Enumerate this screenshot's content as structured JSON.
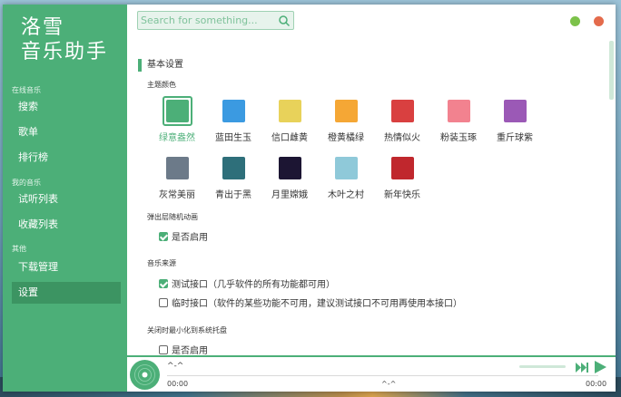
{
  "app": {
    "logo_line1": "洛雪",
    "logo_line2": "音乐助手"
  },
  "sidebar": {
    "sections": [
      {
        "title": "在线音乐",
        "items": [
          {
            "label": "搜索"
          },
          {
            "label": "歌单"
          },
          {
            "label": "排行榜"
          }
        ]
      },
      {
        "title": "我的音乐",
        "items": [
          {
            "label": "试听列表"
          },
          {
            "label": "收藏列表"
          }
        ]
      },
      {
        "title": "其他",
        "items": [
          {
            "label": "下载管理"
          },
          {
            "label": "设置",
            "active": true
          }
        ]
      }
    ]
  },
  "search": {
    "placeholder": "Search for something..."
  },
  "settings": {
    "section_title": "基本设置",
    "theme": {
      "label": "主题颜色",
      "selected": "绿意盎然",
      "items": [
        {
          "name": "绿意盎然",
          "color": "#4caf78"
        },
        {
          "name": "蓝田生玉",
          "color": "#3b9ae1"
        },
        {
          "name": "信口雌黄",
          "color": "#e8d25a"
        },
        {
          "name": "橙黄橘绿",
          "color": "#f5a735"
        },
        {
          "name": "热情似火",
          "color": "#d94040"
        },
        {
          "name": "粉装玉琢",
          "color": "#f2828f"
        },
        {
          "name": "重斤球紫",
          "color": "#9b59b6"
        },
        {
          "name": "灰常美丽",
          "color": "#6c7a89"
        },
        {
          "name": "青出于黑",
          "color": "#2e6f7a"
        },
        {
          "name": "月里嫦娥",
          "color": "#1c1533"
        },
        {
          "name": "木叶之村",
          "color": "#8fc9d9"
        },
        {
          "name": "新年快乐",
          "color": "#c0272d"
        }
      ]
    },
    "popup_anim": {
      "label": "弹出层随机动画",
      "option": "是否启用",
      "checked": true
    },
    "music_source": {
      "label": "音乐来源",
      "options": [
        {
          "text": "测试接口（几乎软件的所有功能都可用）",
          "checked": true
        },
        {
          "text": "临时接口（软件的某些功能不可用，建议测试接口不可用再使用本接口）",
          "checked": false
        }
      ]
    },
    "minimize_tray": {
      "label": "关闭时最小化到系统托盘",
      "option": "是否启用",
      "checked": false
    }
  },
  "player": {
    "title": "^-^",
    "time_current": "00:00",
    "time_total": "00:00",
    "center_label": "^-^"
  },
  "colors": {
    "accent": "#4caf78",
    "sidebar_active": "#3c9462",
    "minimize": "#7cc24a",
    "close": "#e46b4c"
  }
}
